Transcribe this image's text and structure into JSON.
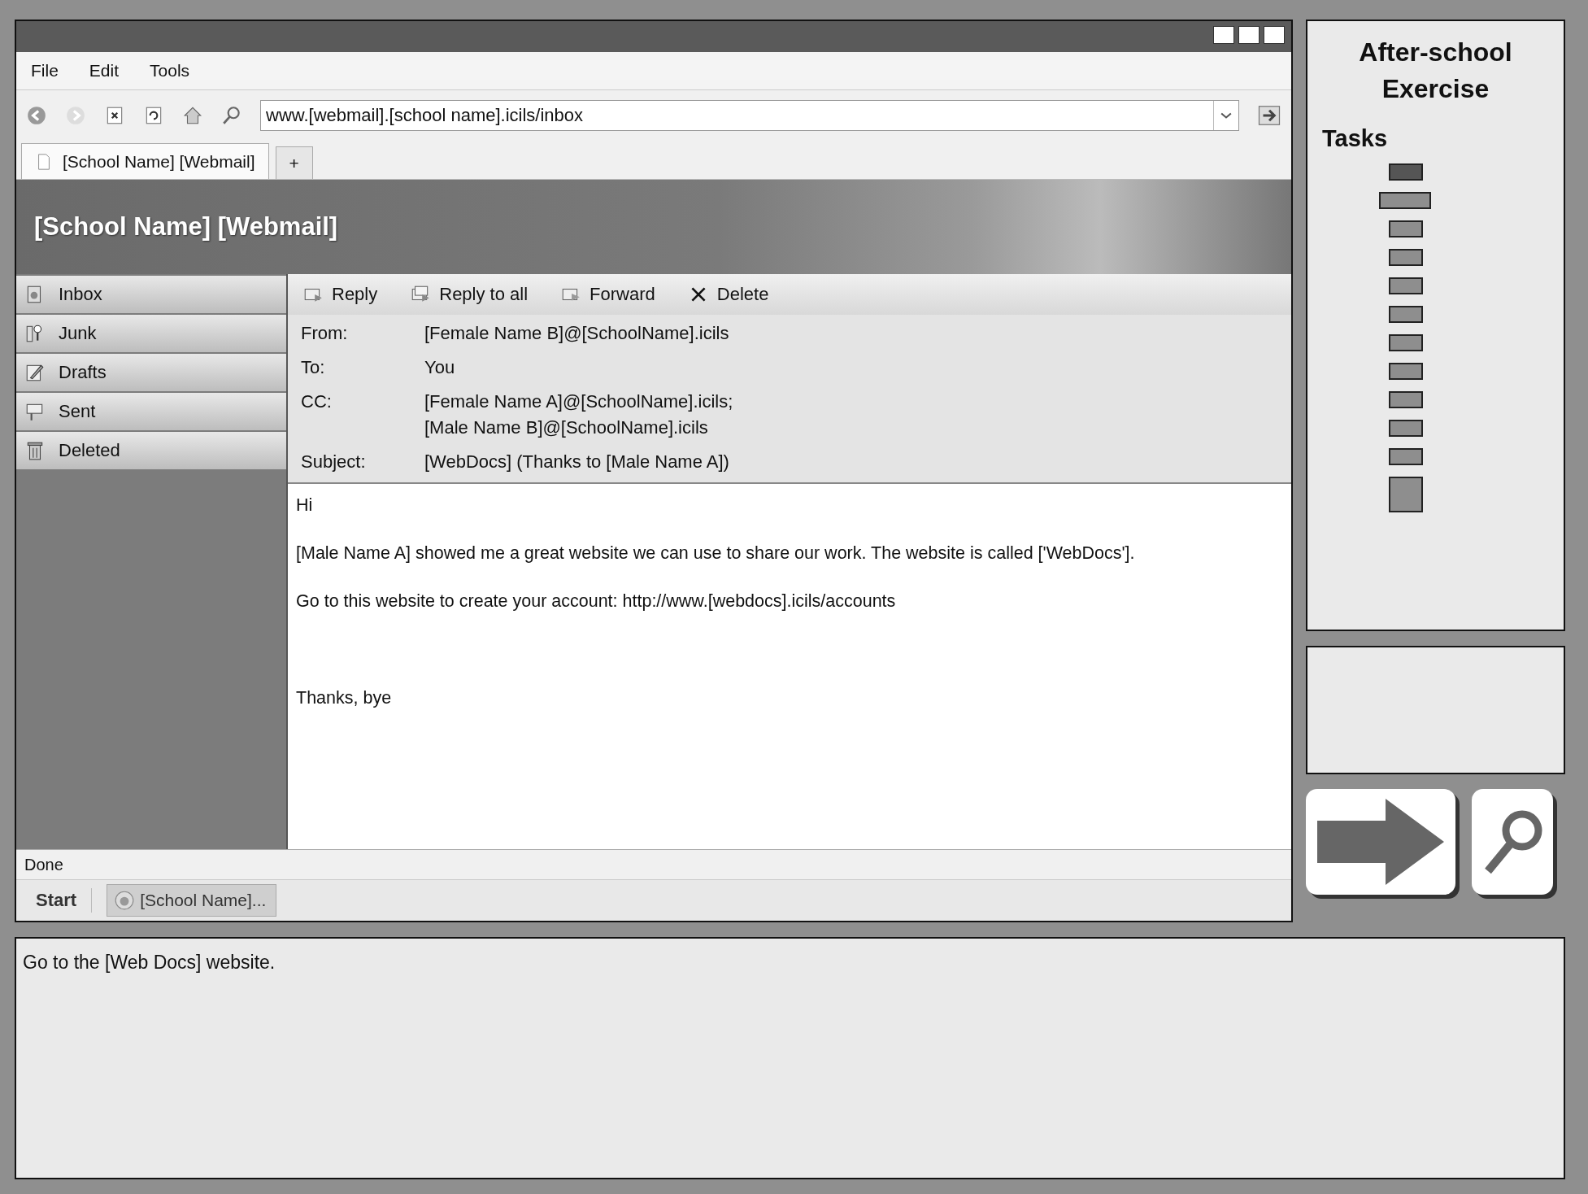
{
  "browser": {
    "menu": [
      "File",
      "Edit",
      "Tools"
    ],
    "address": "www.[webmail].[school name].icils/inbox",
    "tabs": [
      {
        "label": "[School Name] [Webmail]",
        "selected": true
      },
      {
        "label": "+",
        "selected": false
      }
    ],
    "banner_title": "[School Name] [Webmail]",
    "folders": [
      "Inbox",
      "Junk",
      "Drafts",
      "Sent",
      "Deleted"
    ],
    "actions": [
      "Reply",
      "Reply to all",
      "Forward",
      "Delete"
    ],
    "headers": [
      {
        "label": "From:",
        "value": [
          "[Female Name B]@[SchoolName].icils"
        ]
      },
      {
        "label": "To:",
        "value": [
          "You"
        ]
      },
      {
        "label": "CC:",
        "value": [
          "[Female Name A]@[SchoolName].icils;",
          "[Male Name B]@[SchoolName].icils"
        ]
      },
      {
        "label": "Subject:",
        "value": [
          "[WebDocs] (Thanks to [Male Name A])"
        ]
      }
    ],
    "body": [
      "Hi",
      "[Male Name A] showed me a great website we can use to share our work. The website is called ['WebDocs'].",
      "Go to this website to create your account: http://www.[webdocs].icils/accounts"
    ],
    "sign_off": "Thanks, bye",
    "status": "Done",
    "taskbar": {
      "start": "Start",
      "item": "[School Name]..."
    }
  },
  "panel": {
    "title": "After-school Exercise",
    "tasks_label": "Tasks",
    "tasks": [
      {
        "kind": "small",
        "selected": true
      },
      {
        "kind": "wide",
        "selected": false
      },
      {
        "kind": "small",
        "selected": false
      },
      {
        "kind": "small",
        "selected": false
      },
      {
        "kind": "small",
        "selected": false
      },
      {
        "kind": "small",
        "selected": false
      },
      {
        "kind": "small",
        "selected": false
      },
      {
        "kind": "small",
        "selected": false
      },
      {
        "kind": "small",
        "selected": false
      },
      {
        "kind": "small",
        "selected": false
      },
      {
        "kind": "small",
        "selected": false
      },
      {
        "kind": "tall",
        "selected": false
      }
    ]
  },
  "instruction": "Go to the [Web Docs] website."
}
